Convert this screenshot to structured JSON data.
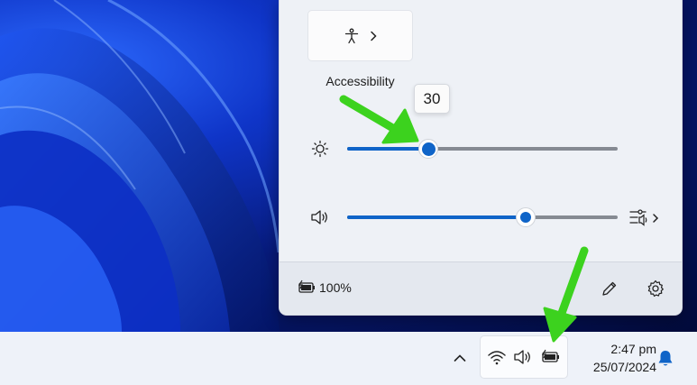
{
  "quick_settings": {
    "accessibility_tile": {
      "label": "Accessibility",
      "icon": "accessibility-icon",
      "chevron": "chevron-right-icon"
    },
    "brightness": {
      "icon": "brightness-icon",
      "value": 30,
      "tooltip": "30"
    },
    "volume": {
      "icon": "speaker-icon",
      "value": 66,
      "mixer_icon": "sound-mixer-icon"
    },
    "footer": {
      "battery_icon": "battery-charging-icon",
      "battery_text": "100%",
      "edit_icon": "pencil-icon",
      "settings_icon": "gear-icon"
    }
  },
  "taskbar": {
    "overflow_icon": "chevron-up-icon",
    "tray_icons": [
      "wifi-icon",
      "speaker-icon",
      "battery-charging-icon"
    ],
    "time": "2:47 pm",
    "date": "25/07/2024",
    "notification_icon": "bell-icon"
  },
  "colors": {
    "accent": "#0f64c8",
    "annotation_arrow": "#3cd21e"
  }
}
